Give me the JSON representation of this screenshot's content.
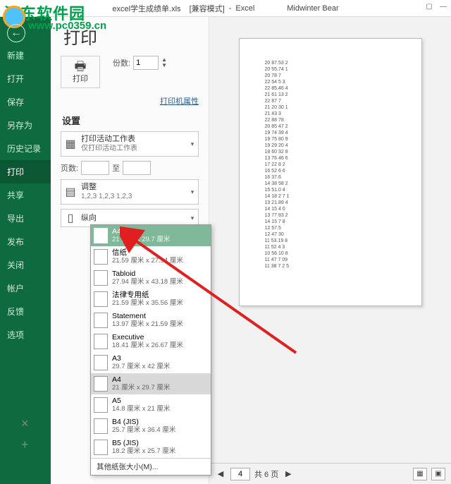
{
  "title": {
    "file": "excel学生成绩单.xls",
    "mode": "[兼容模式]",
    "app": "Excel",
    "user": "Midwinter Bear"
  },
  "watermark": {
    "line1": "河东软件园",
    "line2": "www.pc0359.cn"
  },
  "sidebar": {
    "items": [
      "新建",
      "打开",
      "保存",
      "另存为",
      "历史记录",
      "打印",
      "共享",
      "导出",
      "发布",
      "关闭",
      "帐户",
      "反馈",
      "选项"
    ],
    "selected_index": 5
  },
  "print_panel": {
    "title": "打印",
    "print_btn": "打印",
    "copies_label": "份数:",
    "copies_value": "1",
    "printer_props": "打印机属性",
    "settings_title": "设置",
    "setting_scope": {
      "title": "打印活动工作表",
      "sub": "仅打印活动工作表"
    },
    "pages": {
      "label": "页数:",
      "from": "",
      "to_label": "至",
      "to": ""
    },
    "collate": {
      "title": "调整",
      "sub": "1,2,3   1,2,3   1,2,3"
    },
    "orientation": {
      "title": "纵向"
    }
  },
  "paper_dropdown": {
    "items": [
      {
        "name": "A4",
        "size": "21 厘米 x 29.7 厘米",
        "selected": true
      },
      {
        "name": "信纸",
        "size": "21.59 厘米 x 27.94 厘米"
      },
      {
        "name": "Tabloid",
        "size": "27.94 厘米 x 43.18 厘米"
      },
      {
        "name": "法律专用纸",
        "size": "21.59 厘米 x 35.56 厘米"
      },
      {
        "name": "Statement",
        "size": "13.97 厘米 x 21.59 厘米"
      },
      {
        "name": "Executive",
        "size": "18.41 厘米 x 26.67 厘米"
      },
      {
        "name": "A3",
        "size": "29.7 厘米 x 42 厘米"
      },
      {
        "name": "A4",
        "size": "21 厘米 x 29.7 厘米",
        "hl": true
      },
      {
        "name": "A5",
        "size": "14.8 厘米 x 21 厘米"
      },
      {
        "name": "B4 (JIS)",
        "size": "25.7 厘米 x 36.4 厘米"
      },
      {
        "name": "B5 (JIS)",
        "size": "18.2 厘米 x 25.7 厘米"
      }
    ],
    "footer": "其他纸张大小(M)..."
  },
  "preview": {
    "rows": [
      "20 87.53 2",
      "20 55.74 1",
      "20 78 7",
      "22 54 5 3",
      "22 85.46 4",
      "21 61 13 2",
      "22 87 7",
      "21 20 30 1",
      "21 43 3",
      "22 88 78",
      "20 85 47 2",
      "19 74 39 4",
      "19 75 80 9",
      "19 29 20 4",
      "18 60 32 8",
      "13 76 46 6",
      "17 22 8 2",
      "16 52 6 6",
      "16 37.6",
      "14 38 58 2",
      "15 51.0 4",
      "14 18 2 7 1",
      "13 21.89 4",
      "14 15 4 0",
      "13 77 83 2",
      "14 15 7 8",
      "12 57.5",
      "12 47 30",
      "11 53.19 8",
      "11 52 4 3",
      "10 56 10 8",
      "11 47 7 09",
      "11 38 7 2 5"
    ],
    "current_page": "4",
    "total_label": "共 6 页"
  }
}
